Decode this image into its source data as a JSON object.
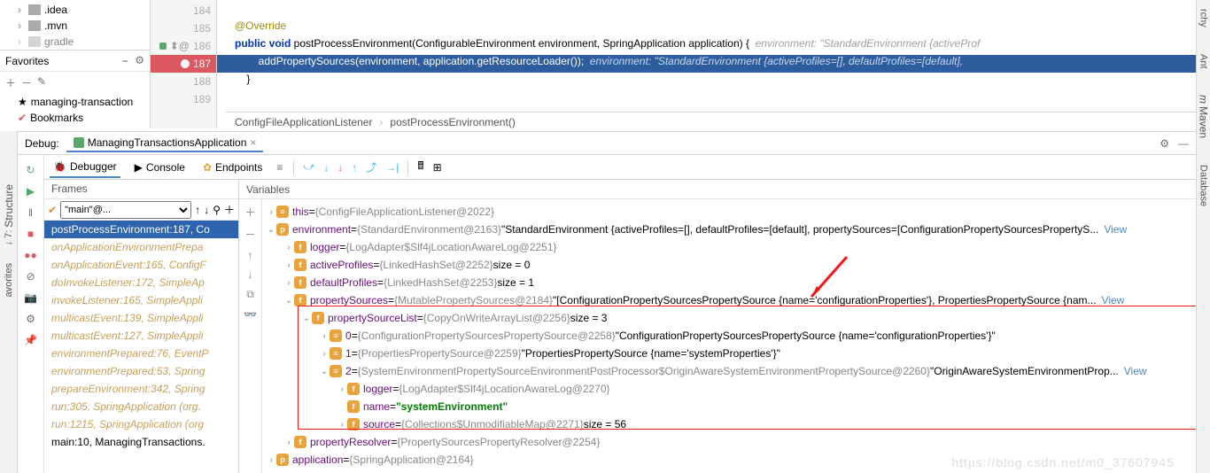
{
  "project": {
    "items": [
      ".idea",
      ".mvn",
      "gradle"
    ]
  },
  "favorites": {
    "title": "Favorites",
    "items": [
      "managing-transaction",
      "Bookmarks"
    ]
  },
  "gutter": [
    "184",
    "185",
    "186",
    "187",
    "188",
    "189"
  ],
  "code": {
    "l185": "@Override",
    "l186_kw": "public void ",
    "l186_method": "postProcessEnvironment(ConfigurableEnvironment environment, SpringApplication application) {",
    "l186_hint": "  environment: \"StandardEnvironment {activeProf",
    "l187": "        addPropertySources(environment, application.getResourceLoader());",
    "l187_hint": "  environment: \"StandardEnvironment {activeProfiles=[], defaultProfiles=[default],",
    "l188": "    }"
  },
  "breadcrumb": {
    "a": "ConfigFileApplicationListener",
    "b": "postProcessEnvironment()"
  },
  "debug": {
    "label": "Debug:",
    "app": "ManagingTransactionsApplication"
  },
  "tabs": {
    "debugger": "Debugger",
    "console": "Console",
    "endpoints": "Endpoints"
  },
  "frames_title": "Frames",
  "thread": "\"main\"@...",
  "frames": [
    "postProcessEnvironment:187, Co",
    "onApplicationEnvironmentPrepa",
    "onApplicationEvent:165, ConfigF",
    "doInvokeListener:172, SimpleAp",
    "invokeListener:165, SimpleAppli",
    "multicastEvent:139, SimpleAppli",
    "multicastEvent:127, SimpleAppli",
    "environmentPrepared:76, EventP",
    "environmentPrepared:53, Spring",
    "prepareEnvironment:342, Spring",
    "run:305, SpringApplication (org.",
    "run:1215, SpringApplication (org",
    "main:10, ManagingTransactions."
  ],
  "vars_title": "Variables",
  "vars": {
    "this": {
      "name": "this",
      "type": "{ConfigFileApplicationListener@2022}"
    },
    "environment": {
      "name": "environment",
      "type": "{StandardEnvironment@2163}",
      "str": "\"StandardEnvironment {activeProfiles=[], defaultProfiles=[default], propertySources=[ConfigurationPropertySourcesPropertyS..."
    },
    "logger": {
      "name": "logger",
      "type": "{LogAdapter$Slf4jLocationAwareLog@2251}"
    },
    "activeProfiles": {
      "name": "activeProfiles",
      "type": "{LinkedHashSet@2252}",
      "size": "size = 0"
    },
    "defaultProfiles": {
      "name": "defaultProfiles",
      "type": "{LinkedHashSet@2253}",
      "size": "size = 1"
    },
    "propertySources": {
      "name": "propertySources",
      "type": "{MutablePropertySources@2184}",
      "str": "\"[ConfigurationPropertySourcesPropertySource {name='configurationProperties'}, PropertiesPropertySource {nam..."
    },
    "propertySourceList": {
      "name": "propertySourceList",
      "type": "{CopyOnWriteArrayList@2256}",
      "size": "size = 3"
    },
    "psl0": {
      "name": "0",
      "type": "{ConfigurationPropertySourcesPropertySource@2258}",
      "str": "\"ConfigurationPropertySourcesPropertySource {name='configurationProperties'}\""
    },
    "psl1": {
      "name": "1",
      "type": "{PropertiesPropertySource@2259}",
      "str": "\"PropertiesPropertySource {name='systemProperties'}\""
    },
    "psl2": {
      "name": "2",
      "type": "{SystemEnvironmentPropertySourceEnvironmentPostProcessor$OriginAwareSystemEnvironmentPropertySource@2260}",
      "str": "\"OriginAwareSystemEnvironmentProp..."
    },
    "psl2_logger": {
      "name": "logger",
      "type": "{LogAdapter$Slf4jLocationAwareLog@2270}"
    },
    "psl2_name": {
      "name": "name",
      "val": "\"systemEnvironment\""
    },
    "psl2_source": {
      "name": "source",
      "type": "{Collections$UnmodifiableMap@2271}",
      "size": "size = 56"
    },
    "propertyResolver": {
      "name": "propertyResolver",
      "type": "{PropertySourcesPropertyResolver@2254}"
    },
    "application": {
      "name": "application",
      "type": "{SpringApplication@2164}"
    }
  },
  "view": "View",
  "rside": [
    "rchy",
    "Ant",
    "Maven",
    "Database"
  ],
  "farleft": [
    "Structure",
    "avorites"
  ],
  "watermark": "https://blog.csdn.net/m0_37607945"
}
